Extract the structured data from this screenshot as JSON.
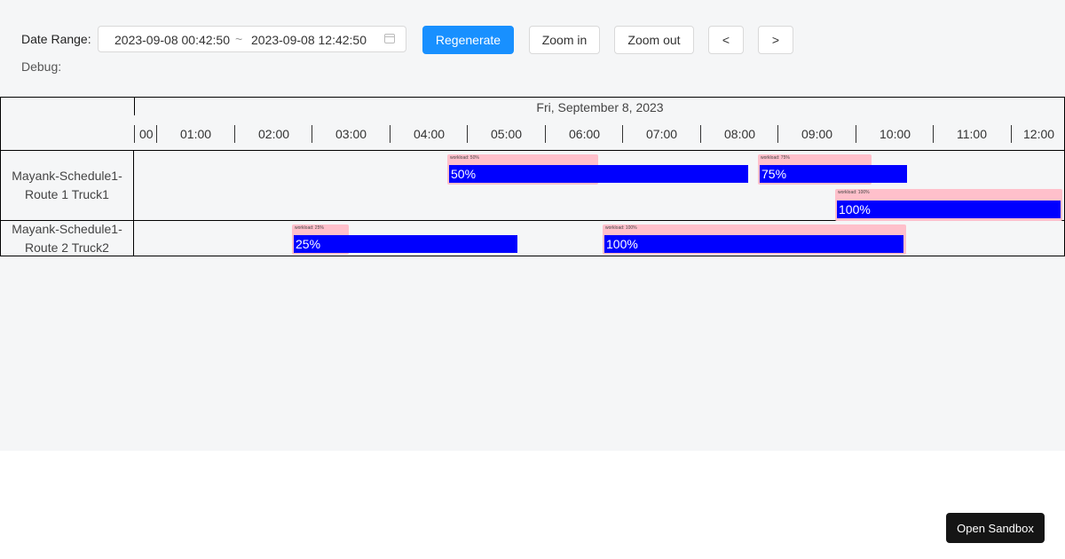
{
  "toolbar": {
    "date_range_label": "Date Range",
    "range_start": "2023-09-08 00:42:50",
    "range_separator": "~",
    "range_end": "2023-09-08 12:42:50",
    "regenerate_label": "Regenerate",
    "zoom_in_label": "Zoom in",
    "zoom_out_label": "Zoom out",
    "prev_label": "<",
    "next_label": ">",
    "debug_label": "Debug:"
  },
  "timeline": {
    "date": "Fri, September 8, 2023",
    "hours": [
      "00",
      "01:00",
      "02:00",
      "03:00",
      "04:00",
      "05:00",
      "06:00",
      "07:00",
      "08:00",
      "09:00",
      "10:00",
      "11:00",
      "12:00"
    ]
  },
  "rows": [
    {
      "line1": "Mayank-Schedule1-",
      "line2": "Route 1 Truck1"
    },
    {
      "line1": "Mayank-Schedule1-",
      "line2": "Route 2 Truck2"
    }
  ],
  "tasks": [
    {
      "mini": "workload: 50%",
      "bar": "50%"
    },
    {
      "mini": "workload: 75%",
      "bar": "75%"
    },
    {
      "mini": "workload: 100%",
      "bar": "100%"
    },
    {
      "mini": "workload: 25%",
      "bar": "25%"
    },
    {
      "mini": "workload: 100%",
      "bar": "100%"
    }
  ],
  "sandbox_label": "Open Sandbox",
  "colors": {
    "primary": "#1890ff",
    "task_bg": "#ffc0cb",
    "progress": "#0000ff"
  }
}
